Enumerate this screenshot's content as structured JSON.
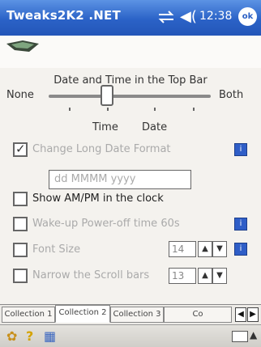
{
  "titlebar": {
    "app_name": "Tweaks2K2 .NET",
    "time": "12:38",
    "ok_label": "ok"
  },
  "slider": {
    "title": "Date and Time in the Top Bar",
    "left_label": "None",
    "right_label": "Both",
    "stop_labels": [
      "Time",
      "Date"
    ],
    "level_stop": 2,
    "stop_count": 4
  },
  "options": {
    "change_long_date": {
      "label": "Change Long Date Format",
      "checked": true,
      "enabled": false
    },
    "format_value": "dd MMMM yyyy",
    "show_ampm": {
      "label": "Show AM/PM in the clock",
      "checked": false,
      "enabled": true
    },
    "wake_up": {
      "label": "Wake-up Power-off time 60s",
      "checked": false,
      "enabled": false
    },
    "font_size": {
      "label": "Font Size",
      "checked": false,
      "enabled": false,
      "value": "14"
    },
    "narrow_scroll": {
      "label": "Narrow the Scroll bars",
      "checked": false,
      "enabled": false,
      "value": "13"
    }
  },
  "buttons": {
    "info_label": "i"
  },
  "tabs": [
    {
      "label": "Collection 1",
      "active": false
    },
    {
      "label": "Collection 2",
      "active": true
    },
    {
      "label": "Collection 3",
      "active": false
    },
    {
      "label": "Co",
      "active": false
    }
  ],
  "colors": {
    "titlebar": "#2b62c7",
    "accent_button": "#2f5ec7",
    "disabled_text": "#aaaaaa"
  },
  "icons": [
    "signal-icon",
    "volume-icon",
    "ok-icon",
    "info-button-icon",
    "tab-left-arrow-icon",
    "tab-right-arrow-icon",
    "start-icon",
    "help-icon",
    "calendar-icon",
    "keyboard-icon"
  ]
}
